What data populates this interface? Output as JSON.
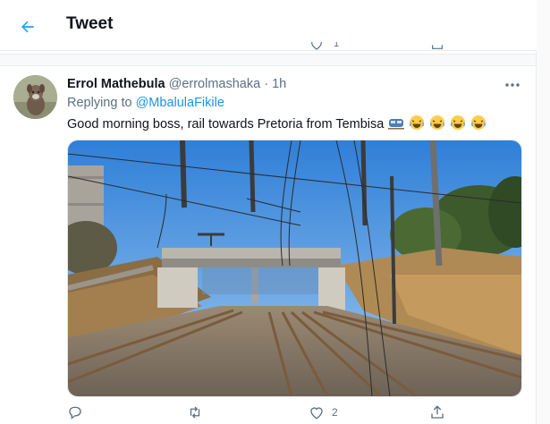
{
  "header": {
    "title": "Tweet",
    "back_icon": "arrow-left-icon",
    "accent": "#1da1f2"
  },
  "previous_tweet_actions": {
    "like_count": "1"
  },
  "tweet": {
    "author_name": "Errol Mathebula",
    "author_handle": "@errolmashaka",
    "separator": "·",
    "time": "1h",
    "reply_prefix": "Replying to",
    "reply_mention": "@MbalulaFikile",
    "text": "Good morning boss, rail towards Pretoria from Tembisa",
    "emojis": [
      "train-emoji",
      "laughing-emoji",
      "laughing-emoji",
      "laughing-emoji",
      "laughing-emoji"
    ],
    "media_description_icon": "railway-photo",
    "actions": {
      "reply_count": "",
      "retweet_count": "",
      "like_count": "2",
      "share_count": ""
    }
  },
  "colors": {
    "text": "#0f1419",
    "secondary": "#5b7083",
    "link": "#1b95e0",
    "border": "#ebeef0"
  }
}
